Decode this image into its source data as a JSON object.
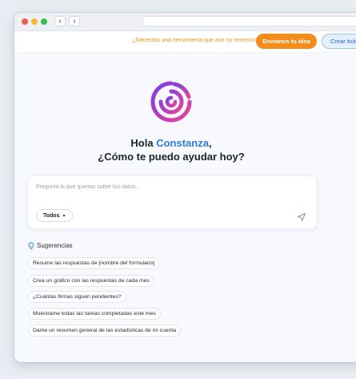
{
  "topbar": {
    "promo_text": "¿Necesitas una herramienta que aún no tenemos?",
    "idea_button": "Envíanos tu idea",
    "ticket_button": "Crear ticket"
  },
  "greeting": {
    "hello": "Hola",
    "user_name": "Constanza",
    "comma": ",",
    "question": "¿Cómo te puedo ayudar hoy?"
  },
  "chat": {
    "placeholder": "Pregunta lo que quieras sobre tus datos...",
    "scope_selected": "Todos"
  },
  "suggestions": {
    "title": "Sugerencias",
    "items": [
      "Resume las respuestas de [nombre del formulario]",
      "Crea un gráfico con las respuestas de cada mes",
      "¿Cuántas firmas siguen pendientes?",
      "Muéstrame todas las tareas completadas este mes",
      "Dame un resumen general de las estadísticas de mi cuenta"
    ]
  },
  "colors": {
    "accent_orange": "#f28c1c",
    "accent_blue": "#2f7be0",
    "logo_gradient": [
      "#7b3fe4",
      "#e8429a"
    ]
  },
  "icons": [
    "back-arrow-icon",
    "forward-arrow-icon",
    "app-logo-icon",
    "chevron-down-icon",
    "send-icon",
    "lightbulb-icon"
  ]
}
